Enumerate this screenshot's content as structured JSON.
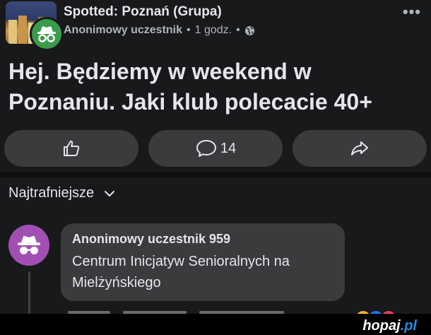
{
  "post": {
    "group_name": "Spotted: Poznań (Grupa)",
    "author": "Anonimowy uczestnik",
    "separator": "•",
    "time": "1 godz.",
    "more_icon": "•••",
    "text_line1": "Hej. Będziemy w weekend w",
    "text_line2": "Poznaniu. Jaki klub polecacie 40+"
  },
  "actions": {
    "like_icon": "thumbs-up-icon",
    "comment_icon": "comment-bubble-icon",
    "comment_count": "14",
    "share_icon": "share-arrow-icon"
  },
  "sort": {
    "label": "Najtrafniejsze",
    "icon": "chevron-down-icon"
  },
  "comment": {
    "author": "Anonimowy uczestnik 959",
    "text_line1": "Centrum Inicjatyw Senioralnych na",
    "text_line2": "Mielżyńskiego",
    "avatar_color": "#a24fb4"
  },
  "watermark": {
    "text": "hopaj",
    "suffix": ".pl"
  },
  "colors": {
    "background": "#18191a",
    "button": "#3a3b3c",
    "text": "#e4e6eb",
    "secondary_text": "#b0b3b8",
    "anon_badge": "#3a9b4d"
  }
}
